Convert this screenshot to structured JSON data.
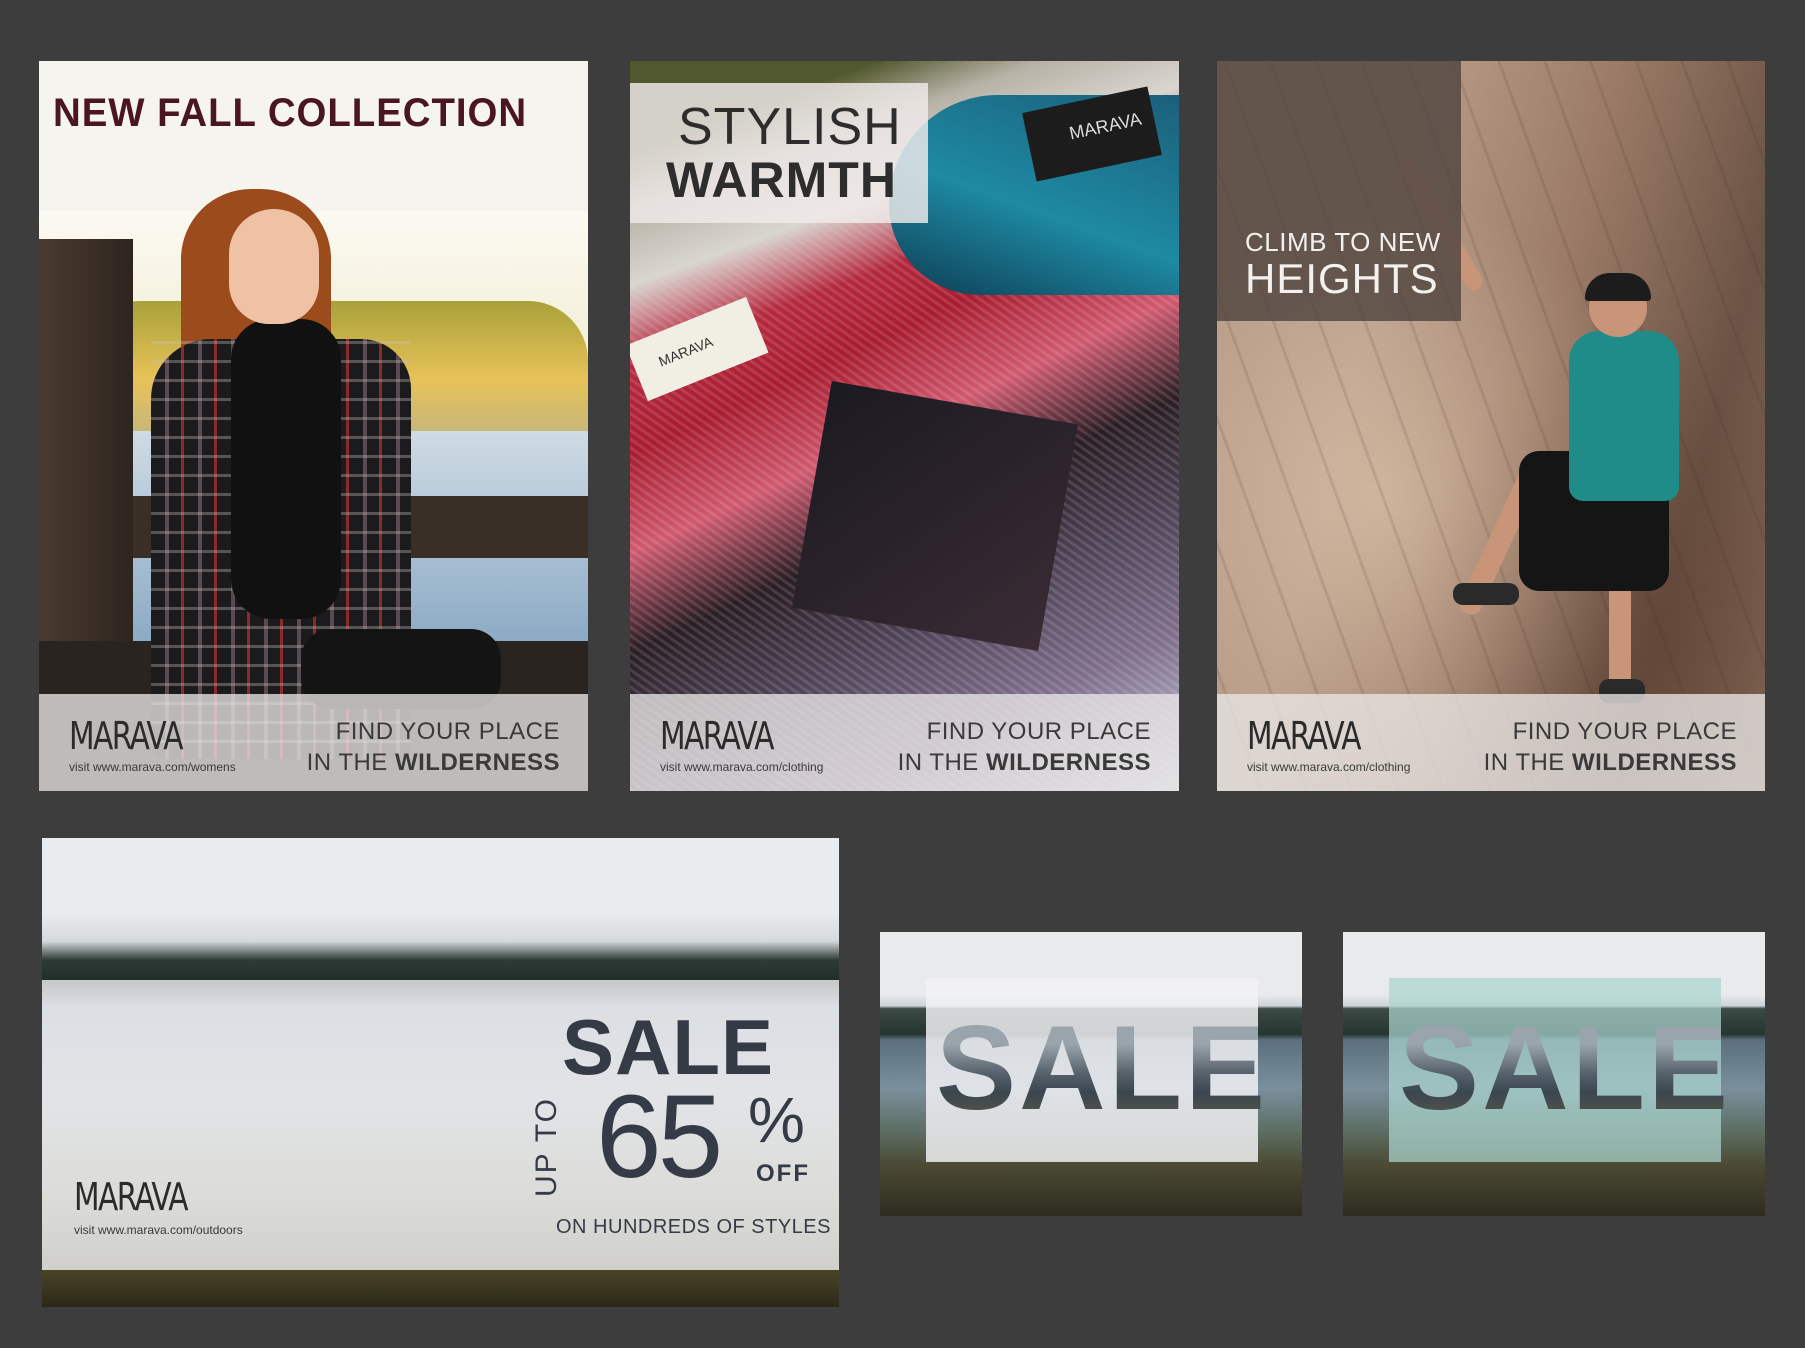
{
  "brand": "MARAVA",
  "tagline": {
    "line1": "FIND YOUR PLACE",
    "line2_prefix": "IN THE ",
    "line2_bold": "WILDERNESS"
  },
  "posters": [
    {
      "headline": "NEW FALL COLLECTION",
      "url": "visit www.marava.com/womens"
    },
    {
      "headline_line1": "STYLISH",
      "headline_line2": "WARMTH",
      "url": "visit www.marava.com/clothing",
      "label_text": "MARAVA"
    },
    {
      "headline_line1": "CLIMB TO NEW",
      "headline_line2": "HEIGHTS",
      "url": "visit www.marava.com/clothing"
    }
  ],
  "banner_large": {
    "sale": "SALE",
    "up_to": "UP TO",
    "percent": "65",
    "percent_sign": "%",
    "off": "OFF",
    "subline": "ON HUNDREDS OF STYLES",
    "url": "visit www.marava.com/outdoors"
  },
  "banner_small": [
    {
      "sale": "SALE",
      "box_color": "#f2f2f4"
    },
    {
      "sale": "SALE",
      "box_color": "#aad6ce"
    }
  ],
  "colors": {
    "background": "#3d3d3d",
    "headline_maroon": "#4a1620",
    "text_dark": "#343b46"
  }
}
